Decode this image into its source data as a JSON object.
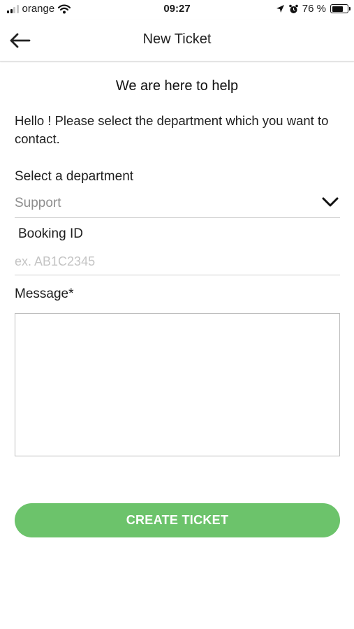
{
  "status_bar": {
    "carrier": "orange",
    "time": "09:27",
    "battery_percent_text": "76 %",
    "battery_level": 0.76,
    "icons": [
      "signal-icon",
      "wifi-icon",
      "location-arrow-icon",
      "alarm-icon",
      "battery-icon"
    ]
  },
  "header": {
    "title": "New Ticket",
    "back_icon": "arrow-left-icon"
  },
  "form": {
    "heading": "We are here to help",
    "intro": "Hello ! Please select the department which you want to contact.",
    "department": {
      "label": "Select a department",
      "value": "Support",
      "icon": "chevron-down-icon"
    },
    "booking_id": {
      "label": "Booking ID",
      "placeholder": "ex. AB1C2345",
      "value": ""
    },
    "message": {
      "label": "Message*",
      "value": ""
    },
    "submit_label": "CREATE TICKET"
  },
  "colors": {
    "accent_green": "#6cc36b",
    "divider": "#cfcfcf",
    "placeholder": "#c4c4c4"
  }
}
